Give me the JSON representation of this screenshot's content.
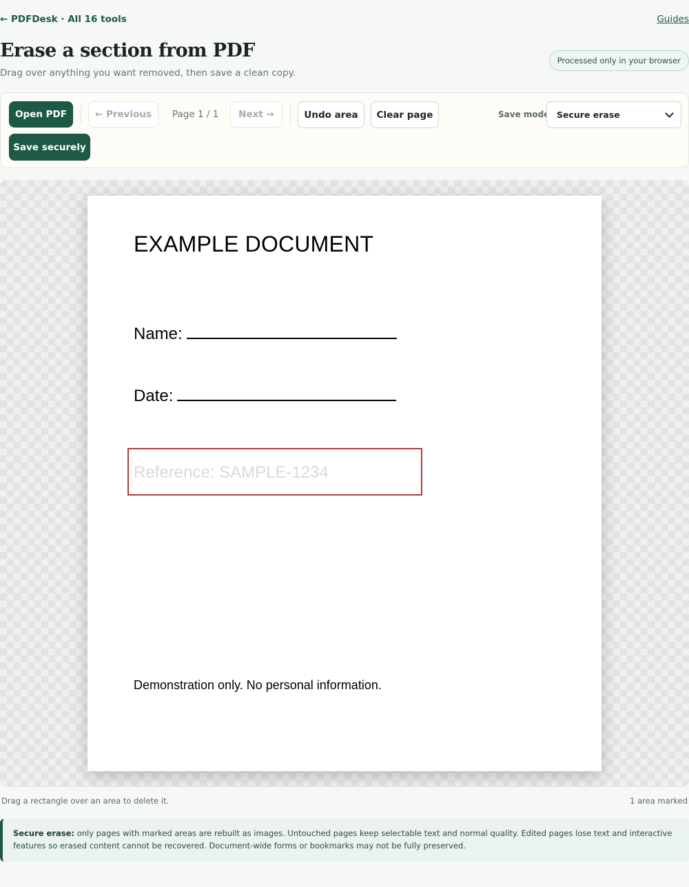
{
  "nav": {
    "back_link": "← PDFDesk · All 16 tools",
    "guides_link": "Guides"
  },
  "header": {
    "title": "Erase a section from PDF",
    "subtitle": "Drag over anything you want removed, then save a clean copy.",
    "privacy_badge": "Processed only in your browser"
  },
  "toolbar": {
    "open_label": "Open PDF",
    "previous_label": "← Previous",
    "page_indicator": "Page 1 / 1",
    "next_label": "Next →",
    "undo_label": "Undo area",
    "clear_label": "Clear page",
    "save_mode_label": "Save mode",
    "save_mode_value": "Secure erase",
    "save_label": "Save securely"
  },
  "document": {
    "title": "EXAMPLE DOCUMENT",
    "name_label": "Name:",
    "date_label": "Date:",
    "reference": "Reference: SAMPLE-1234",
    "footer": "Demonstration only. No personal information."
  },
  "status": {
    "hint": "Drag a rectangle over an area to delete it.",
    "marked_count": "1 area marked"
  },
  "notice": {
    "heading": "Secure erase:",
    "body": "only pages with marked areas are rebuilt as images. Untouched pages keep selectable text and normal quality. Edited pages lose text and interactive features so erased content cannot be recovered. Document-wide forms or bookmarks may not be fully preserved."
  },
  "colors": {
    "primary": "#1d5a45",
    "erase_outline": "#b23a3a",
    "page_background": "#f5f8f6"
  }
}
